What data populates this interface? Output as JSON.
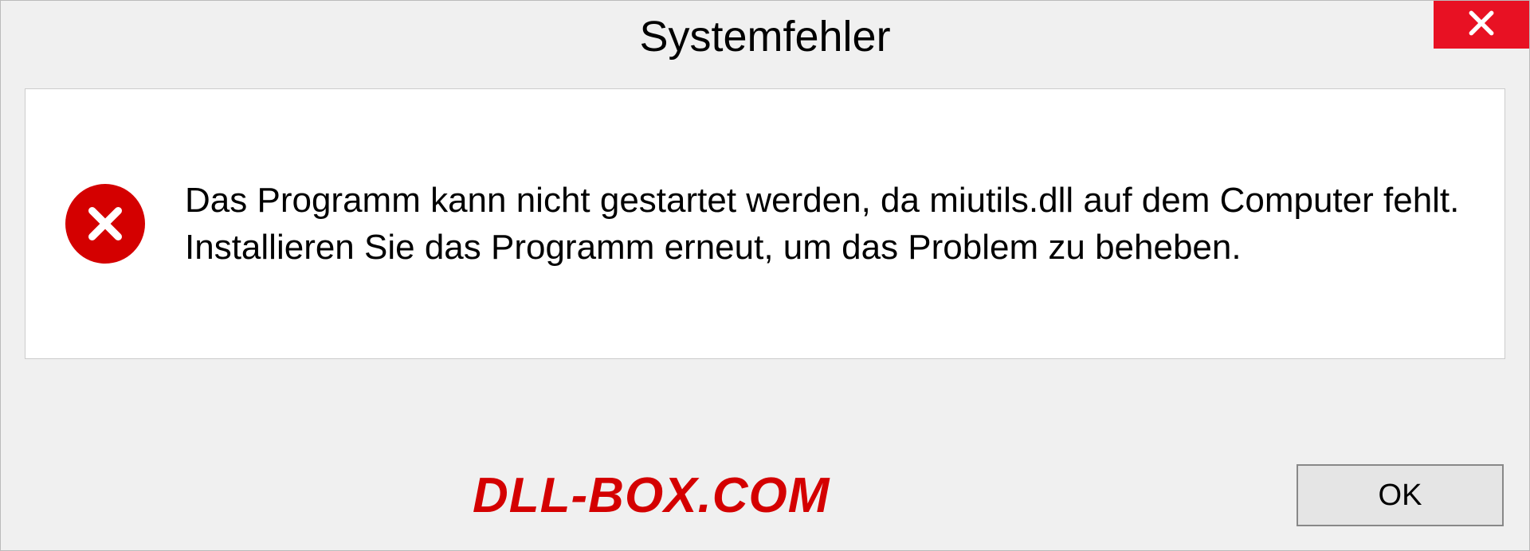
{
  "dialog": {
    "title": "Systemfehler",
    "message": "Das Programm kann nicht gestartet werden, da miutils.dll auf dem Computer fehlt. Installieren Sie das Programm erneut, um das Problem zu beheben.",
    "ok_label": "OK"
  },
  "watermark": {
    "text": "DLL-BOX.COM"
  }
}
